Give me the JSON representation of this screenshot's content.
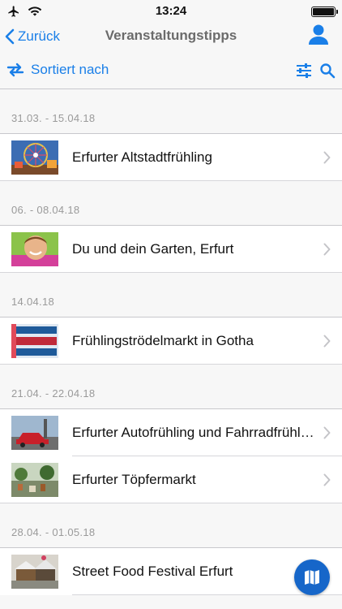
{
  "status_bar": {
    "time": "13:24",
    "icons": [
      "airplane-icon",
      "wifi-icon",
      "battery-icon"
    ]
  },
  "nav": {
    "back_label": "Zurück",
    "title": "Veranstaltungstipps",
    "profile_icon": "person-icon"
  },
  "toolbar": {
    "sort_label": "Sortiert nach",
    "sort_icon": "swap-arrows-icon",
    "filter_icon": "sliders-icon",
    "search_icon": "search-icon"
  },
  "colors": {
    "accent": "#1a7fe8",
    "fab": "#1666c9",
    "section_text": "#9a9a9a"
  },
  "sections": [
    {
      "date": "31.03. - 15.04.18",
      "items": [
        {
          "title": "Erfurter Altstadtfrühling",
          "thumb": "ferris-wheel-photo"
        }
      ]
    },
    {
      "date": "06. - 08.04.18",
      "items": [
        {
          "title": "Du und dein Garten, Erfurt",
          "thumb": "woman-with-flowers-photo"
        }
      ]
    },
    {
      "date": "14.04.18",
      "items": [
        {
          "title": "Frühlingströdelmarkt in Gotha",
          "thumb": "troedelmarkt-poster"
        }
      ]
    },
    {
      "date": "21.04. - 22.04.18",
      "items": [
        {
          "title": "Erfurter Autofrühling und Fahrradfrühling",
          "thumb": "red-car-photo"
        },
        {
          "title": "Erfurter Töpfermarkt",
          "thumb": "pottery-market-photo"
        }
      ]
    },
    {
      "date": "28.04. - 01.05.18",
      "items": [
        {
          "title": "Street Food Festival Erfurt",
          "thumb": "food-stands-photo"
        }
      ]
    }
  ],
  "map_button_icon": "map-icon"
}
